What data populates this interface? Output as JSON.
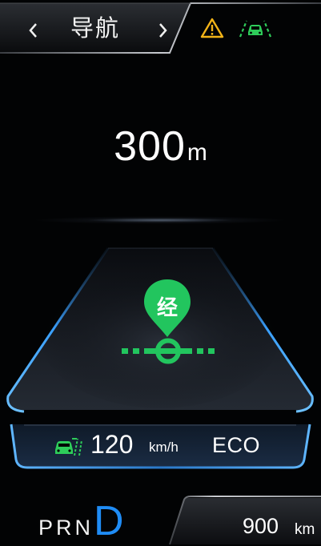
{
  "header": {
    "prev_icon": "chevron-left-icon",
    "title": "导航",
    "next_icon": "chevron-right-icon",
    "warning_icon": "warning-triangle-icon",
    "warning_color": "#f2b318",
    "assist_icon": "car-lane-assist-icon",
    "assist_color": "#2ecc5a"
  },
  "navigation": {
    "distance_value": "300",
    "distance_unit": "m",
    "waypoint_label": "经",
    "waypoint_color": "#22c55e"
  },
  "status": {
    "speed_icon": "speed-limit-car-icon",
    "speed_value": "120",
    "speed_unit": "km/h",
    "drive_mode": "ECO"
  },
  "footer": {
    "gears": [
      "P",
      "R",
      "N"
    ],
    "active_gear": "D",
    "active_gear_color": "#1f8cf5",
    "range_value": "900",
    "range_unit": "km"
  },
  "colors": {
    "background": "#020304",
    "accent_blue": "#3aa0ff",
    "frame_gray": "#6b6f75"
  }
}
